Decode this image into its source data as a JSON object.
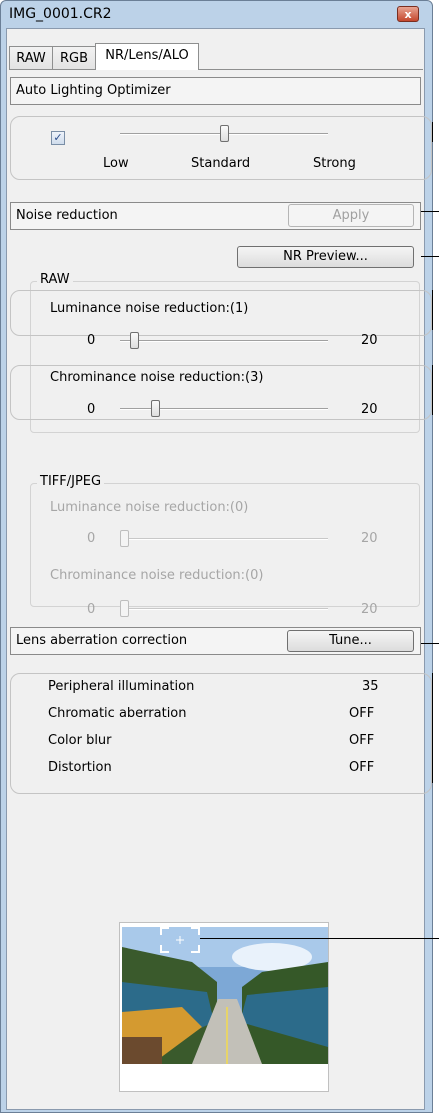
{
  "window": {
    "title": "IMG_0001.CR2",
    "close_label": "x"
  },
  "tabs": [
    {
      "label": "RAW",
      "active": false
    },
    {
      "label": "RGB",
      "active": false
    },
    {
      "label": "NR/Lens/ALO",
      "active": true
    }
  ],
  "alo": {
    "header": "Auto Lighting Optimizer",
    "checked": true,
    "labels": {
      "low": "Low",
      "standard": "Standard",
      "strong": "Strong"
    },
    "level_index": 1,
    "levels_total": 3
  },
  "noise": {
    "header": "Noise reduction",
    "apply_label": "Apply",
    "nr_preview_label": "NR Preview...",
    "raw": {
      "group_label": "RAW",
      "luminance": {
        "label": "Luminance noise reduction:(1)",
        "min": "0",
        "max": "20",
        "value": 1
      },
      "chrominance": {
        "label": "Chrominance noise reduction:(3)",
        "min": "0",
        "max": "20",
        "value": 3
      }
    },
    "tiff": {
      "group_label": "TIFF/JPEG",
      "luminance": {
        "label": "Luminance noise reduction:(0)",
        "min": "0",
        "max": "20",
        "value": 0
      },
      "chrominance": {
        "label": "Chrominance noise reduction:(0)",
        "min": "0",
        "max": "20",
        "value": 0
      }
    }
  },
  "lens": {
    "header": "Lens aberration correction",
    "tune_label": "Tune...",
    "items": [
      {
        "label": "Peripheral illumination",
        "value": "35"
      },
      {
        "label": "Chromatic aberration",
        "value": "OFF"
      },
      {
        "label": "Color blur",
        "value": "OFF"
      },
      {
        "label": "Distortion",
        "value": "OFF"
      }
    ]
  },
  "colors": {
    "window_frame": "#bcd2e8",
    "client_bg": "#f0f0f0",
    "close_red": "#c4472d"
  }
}
